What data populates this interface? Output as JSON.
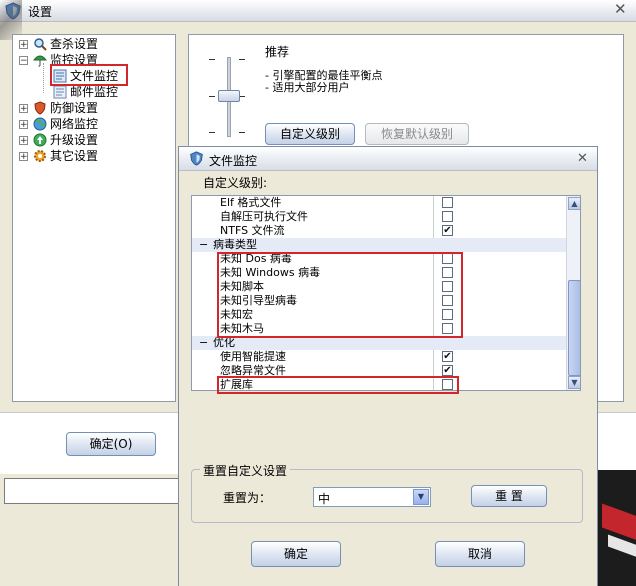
{
  "main_window": {
    "title": "设置",
    "ok_button": "确定(O)",
    "tree": [
      {
        "label": "查杀设置",
        "expander": "+",
        "icon": "magnifier-icon"
      },
      {
        "label": "监控设置",
        "expander": "−",
        "icon": "umbrella-icon"
      },
      {
        "label": "文件监控",
        "expander": "",
        "icon": "file-monitor-icon"
      },
      {
        "label": "邮件监控",
        "expander": "",
        "icon": "mail-monitor-icon"
      },
      {
        "label": "防御设置",
        "expander": "+",
        "icon": "shield-icon"
      },
      {
        "label": "网络监控",
        "expander": "+",
        "icon": "globe-icon"
      },
      {
        "label": "升级设置",
        "expander": "+",
        "icon": "upgrade-icon"
      },
      {
        "label": "其它设置",
        "expander": "+",
        "icon": "gear-icon"
      }
    ],
    "level": {
      "title": "推荐",
      "lines": [
        "- 引擎配置的最佳平衡点",
        "- 适用大部分用户"
      ],
      "slider_value": "推荐",
      "custom_button": "自定义级别",
      "default_button": "恢复默认级别"
    }
  },
  "dialog": {
    "title": "文件监控",
    "section_label": "自定义级别:",
    "rows": [
      {
        "type": "item",
        "label": "Elf 格式文件",
        "checked": false
      },
      {
        "type": "item",
        "label": "自解压可执行文件",
        "checked": false
      },
      {
        "type": "item",
        "label": "NTFS 文件流",
        "checked": true
      },
      {
        "type": "group",
        "label": "病毒类型",
        "expander": "−"
      },
      {
        "type": "item",
        "label": "未知 Dos 病毒",
        "checked": false
      },
      {
        "type": "item",
        "label": "未知 Windows 病毒",
        "checked": false
      },
      {
        "type": "item",
        "label": "未知脚本",
        "checked": false
      },
      {
        "type": "item",
        "label": "未知引导型病毒",
        "checked": false
      },
      {
        "type": "item",
        "label": "未知宏",
        "checked": false
      },
      {
        "type": "item",
        "label": "未知木马",
        "checked": false
      },
      {
        "type": "group",
        "label": "优化",
        "expander": "−"
      },
      {
        "type": "item",
        "label": "使用智能提速",
        "checked": true
      },
      {
        "type": "item",
        "label": "忽略异常文件",
        "checked": true
      },
      {
        "type": "item",
        "label": "扩展库",
        "checked": false
      }
    ],
    "reset_group_title": "重置自定义设置",
    "reset_label": "重置为：",
    "reset_value": "中",
    "reset_button": "重 置",
    "ok_button": "确定",
    "cancel_button": "取消"
  },
  "colors": {
    "highlight_red": "#d3262b",
    "group_row_bg": "#e4ebf6"
  }
}
